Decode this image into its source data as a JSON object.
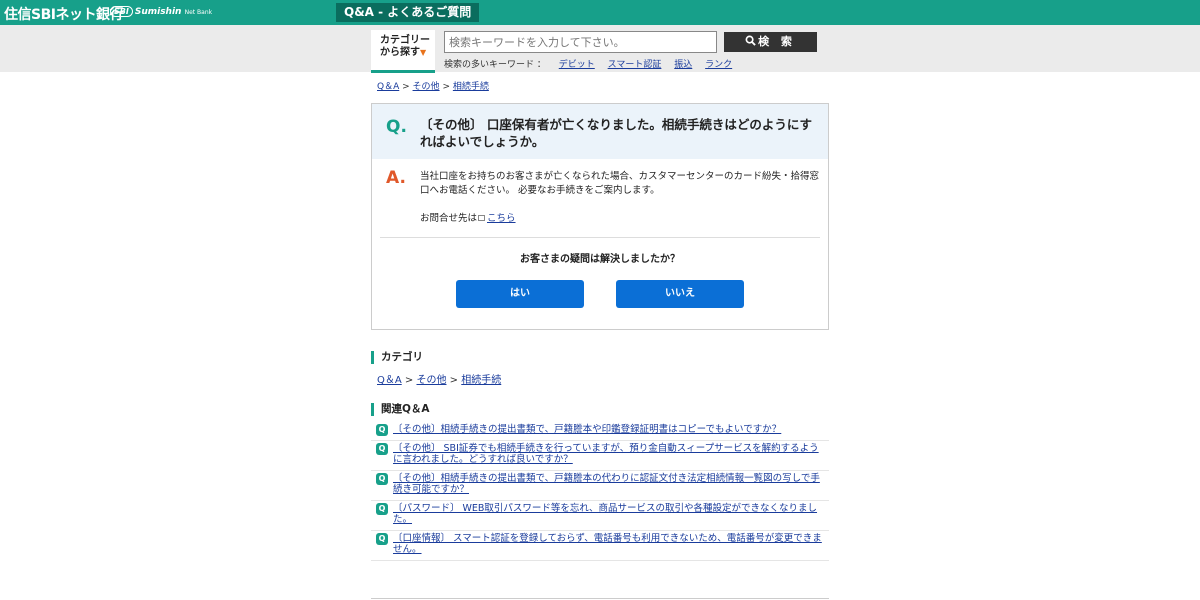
{
  "header": {
    "brand": "住信SBIネット銀行",
    "brand_en_mark": "SBI",
    "brand_en": "Sumishin",
    "brand_en_sub": "Net Bank",
    "page_title": "Q&A - よくあるご質問",
    "accent_color": "#17a08a"
  },
  "search": {
    "category_button_line1": "カテゴリー",
    "category_button_line2": "から探す",
    "category_arrow": "▼",
    "placeholder": "検索キーワードを入力して下さい。",
    "button_label": "検 索",
    "button_icon": "search-icon",
    "keywords_label": "検索の多いキーワード ：",
    "keywords": [
      "デビット",
      "スマート認証",
      "振込",
      "ランク"
    ]
  },
  "breadcrumb": {
    "items": [
      "Q＆A",
      "その他",
      "相続手続"
    ],
    "separator": ">"
  },
  "qa": {
    "q_mark": "Q.",
    "question": "〔その他〕 口座保有者が亡くなりました。相続手続きはどのようにすればよいでしょうか。",
    "a_mark": "A.",
    "answer": "当社口座をお持ちのお客さまが亡くなられた場合、カスタマーセンターのカード紛失・拾得窓口へお電話ください。 必要なお手続きをご案内します。",
    "contact_label": "お問合せ先は",
    "contact_link": "こちら",
    "feedback_question": "お客さまの疑問は解決しましたか？",
    "yes_label": "はい",
    "no_label": "いいえ"
  },
  "category_section": {
    "title": "カテゴリ",
    "links": [
      "Q＆A",
      "その他",
      "相続手続"
    ]
  },
  "related_section": {
    "title": "関連Q＆A",
    "icon_label": "Q",
    "items": [
      "〔その他〕相続手続きの提出書類で、戸籍謄本や印鑑登録証明書はコピーでもよいですか？",
      "〔その他〕 SBI証券でも相続手続きを行っていますが、預り金自動スィープサービスを解約するように言われました。どうすれば良いですか？",
      "〔その他〕相続手続きの提出書類で、戸籍謄本の代わりに認証文付き法定相続情報一覧図の写しで手続き可能ですか？",
      "〔パスワード〕 WEB取引パスワード等を忘れ、商品サービスの取引や各種設定ができなくなりました。",
      "〔口座情報〕 スマート認証を登録しておらず、電話番号も利用できないため、電話番号が変更できません。"
    ]
  }
}
